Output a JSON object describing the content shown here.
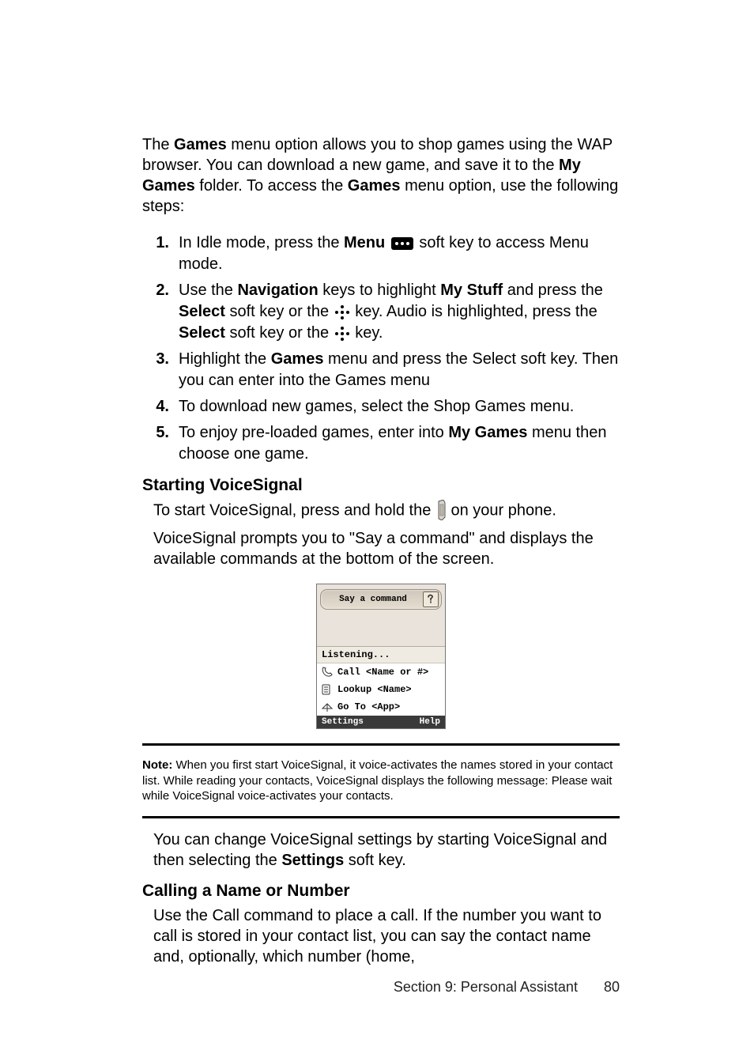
{
  "intro": {
    "t1a": "The ",
    "t1b": "Games",
    "t1c": " menu option allows you to shop games using the WAP browser. You can download a new game, and save it to the ",
    "t1d": "My Games",
    "t1e": " folder. To access the ",
    "t1f": "Games",
    "t1g": " menu option, use the following steps:"
  },
  "steps": {
    "s1": {
      "n": "1.",
      "a": "In Idle mode, press the ",
      "b": "Menu",
      "c": " soft key to access Menu mode."
    },
    "s2": {
      "n": "2.",
      "a": "Use the ",
      "b": "Navigation",
      "c": " keys to highlight ",
      "d": "My Stuff",
      "e": " and press the ",
      "f": "Select",
      "g": " soft key or the ",
      "h": " key. Audio is highlighted, press the ",
      "i": "Select",
      "j": " soft key or the ",
      "k": " key."
    },
    "s3": {
      "n": "3.",
      "a": "Highlight the ",
      "b": "Games",
      "c": " menu and press the Select soft key. Then you can enter into the Games menu"
    },
    "s4": {
      "n": "4.",
      "a": "To download new games, select the Shop Games menu."
    },
    "s5": {
      "n": "5.",
      "a": "To enjoy pre-loaded games, enter into ",
      "b": "My Games",
      "c": " menu then choose one game."
    }
  },
  "vs": {
    "heading": "Starting VoiceSignal",
    "p1a": "To start VoiceSignal, press and hold the ",
    "p1b": " on your phone.",
    "p2": "VoiceSignal prompts you to \"Say a command\" and displays the available commands at the bottom of the screen."
  },
  "phone": {
    "say": "Say a command",
    "listening": "Listening...",
    "cmd1": "Call <Name or #>",
    "cmd2": "Lookup <Name>",
    "cmd3": "Go To <App>",
    "left": "Settings",
    "right": "Help"
  },
  "note": {
    "label": "Note:",
    "text": " When you first start VoiceSignal, it voice-activates the names stored in your contact list. While reading your contacts, VoiceSignal displays the following message: Please wait while VoiceSignal voice-activates your contacts."
  },
  "post": {
    "p1a": "You can change VoiceSignal settings by starting VoiceSignal and then selecting the ",
    "p1b": "Settings",
    "p1c": " soft key."
  },
  "call": {
    "heading": "Calling a Name or Number",
    "p1": "Use the Call command to place a call. If the number you want to call is stored in your contact list, you can say the contact name and, optionally, which number (home,"
  },
  "footer": {
    "section": "Section 9: Personal Assistant",
    "page": "80"
  }
}
